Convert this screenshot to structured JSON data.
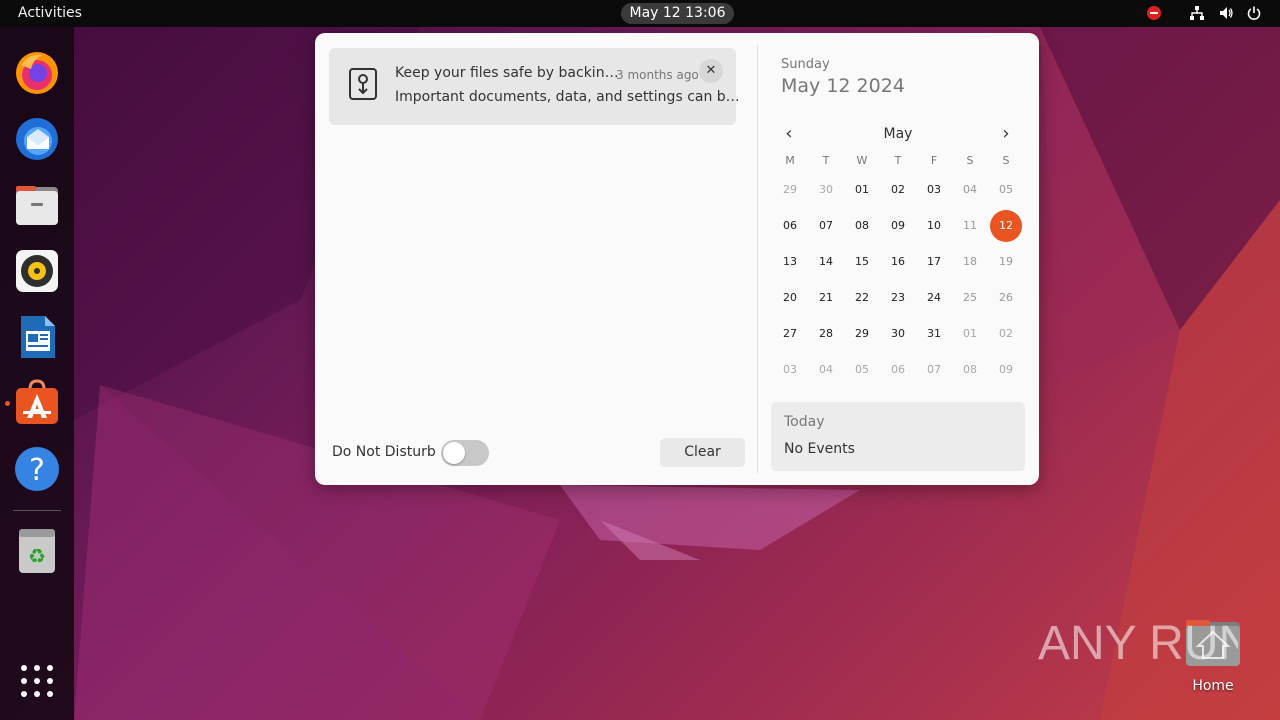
{
  "topbar": {
    "activities": "Activities",
    "clock": "May 12  13:06",
    "tray_icons": [
      "do-not-disturb-icon",
      "network-icon",
      "volume-icon",
      "power-icon"
    ]
  },
  "dock": {
    "apps": [
      "Firefox",
      "Thunderbird",
      "Files",
      "Rhythmbox",
      "LibreOffice Writer",
      "Ubuntu Software",
      "Help",
      "Trash",
      "Show Applications"
    ]
  },
  "desktop": {
    "home_label": "Home",
    "watermark": "ANY RUN"
  },
  "notification": {
    "title": "Keep your files safe by backin…",
    "time": "3 months ago",
    "body": "Important documents, data, and settings can b…",
    "close": "✕"
  },
  "dnd": {
    "label": "Do Not Disturb",
    "enabled": false
  },
  "clear_label": "Clear",
  "calendar": {
    "weekday": "Sunday",
    "date": "May 12 2024",
    "month": "May",
    "prev": "‹",
    "next": "›",
    "headers": [
      "M",
      "T",
      "W",
      "T",
      "F",
      "S",
      "S"
    ],
    "weeks": [
      [
        "29",
        "30",
        "01",
        "02",
        "03",
        "04",
        "05"
      ],
      [
        "06",
        "07",
        "08",
        "09",
        "10",
        "11",
        "12"
      ],
      [
        "13",
        "14",
        "15",
        "16",
        "17",
        "18",
        "19"
      ],
      [
        "20",
        "21",
        "22",
        "23",
        "24",
        "25",
        "26"
      ],
      [
        "27",
        "28",
        "29",
        "30",
        "31",
        "01",
        "02"
      ],
      [
        "03",
        "04",
        "05",
        "06",
        "07",
        "08",
        "09"
      ]
    ],
    "today": "12"
  },
  "events": {
    "title": "Today",
    "none": "No Events"
  },
  "colors": {
    "accent": "#e95420",
    "topbar": "#0b0b0b",
    "popup": "#fafafa"
  }
}
